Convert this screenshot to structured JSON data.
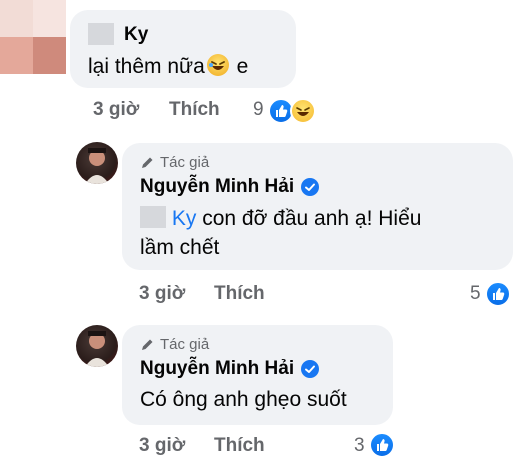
{
  "comments": [
    {
      "author": "Ky",
      "text": "lại thêm nữa",
      "text_suffix": "e",
      "time": "3 giờ",
      "like_label": "Thích",
      "reaction_count": "9",
      "reactions": [
        "like-icon",
        "haha-icon"
      ]
    },
    {
      "author_tag": "Tác giả",
      "author": "Nguyễn Minh Hải",
      "mention": "Ky",
      "text_line1": " con đỡ đầu anh ạ! Hiểu",
      "text_line2": "lầm chết",
      "time": "3 giờ",
      "like_label": "Thích",
      "reaction_count": "5",
      "reactions": [
        "like-icon"
      ]
    },
    {
      "author_tag": "Tác giả",
      "author": "Nguyễn Minh Hải",
      "text": "Có ông anh ghẹo suốt",
      "time": "3 giờ",
      "like_label": "Thích",
      "reaction_count": "3",
      "reactions": [
        "like-icon"
      ]
    }
  ],
  "colors": {
    "bubble": "#f0f2f5",
    "meta": "#65676b",
    "mention": "#1877f2",
    "like": "#1877f2"
  }
}
